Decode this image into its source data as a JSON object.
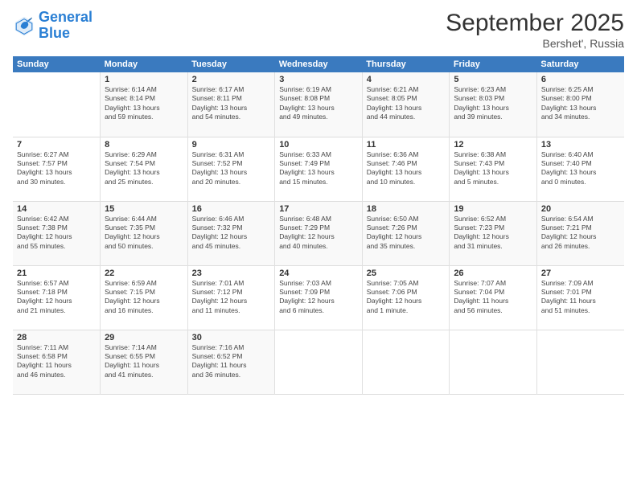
{
  "logo": {
    "line1": "General",
    "line2": "Blue"
  },
  "title": "September 2025",
  "subtitle": "Bershet', Russia",
  "days_of_week": [
    "Sunday",
    "Monday",
    "Tuesday",
    "Wednesday",
    "Thursday",
    "Friday",
    "Saturday"
  ],
  "weeks": [
    [
      {
        "day": "",
        "info": ""
      },
      {
        "day": "1",
        "info": "Sunrise: 6:14 AM\nSunset: 8:14 PM\nDaylight: 13 hours\nand 59 minutes."
      },
      {
        "day": "2",
        "info": "Sunrise: 6:17 AM\nSunset: 8:11 PM\nDaylight: 13 hours\nand 54 minutes."
      },
      {
        "day": "3",
        "info": "Sunrise: 6:19 AM\nSunset: 8:08 PM\nDaylight: 13 hours\nand 49 minutes."
      },
      {
        "day": "4",
        "info": "Sunrise: 6:21 AM\nSunset: 8:05 PM\nDaylight: 13 hours\nand 44 minutes."
      },
      {
        "day": "5",
        "info": "Sunrise: 6:23 AM\nSunset: 8:03 PM\nDaylight: 13 hours\nand 39 minutes."
      },
      {
        "day": "6",
        "info": "Sunrise: 6:25 AM\nSunset: 8:00 PM\nDaylight: 13 hours\nand 34 minutes."
      }
    ],
    [
      {
        "day": "7",
        "info": "Sunrise: 6:27 AM\nSunset: 7:57 PM\nDaylight: 13 hours\nand 30 minutes."
      },
      {
        "day": "8",
        "info": "Sunrise: 6:29 AM\nSunset: 7:54 PM\nDaylight: 13 hours\nand 25 minutes."
      },
      {
        "day": "9",
        "info": "Sunrise: 6:31 AM\nSunset: 7:52 PM\nDaylight: 13 hours\nand 20 minutes."
      },
      {
        "day": "10",
        "info": "Sunrise: 6:33 AM\nSunset: 7:49 PM\nDaylight: 13 hours\nand 15 minutes."
      },
      {
        "day": "11",
        "info": "Sunrise: 6:36 AM\nSunset: 7:46 PM\nDaylight: 13 hours\nand 10 minutes."
      },
      {
        "day": "12",
        "info": "Sunrise: 6:38 AM\nSunset: 7:43 PM\nDaylight: 13 hours\nand 5 minutes."
      },
      {
        "day": "13",
        "info": "Sunrise: 6:40 AM\nSunset: 7:40 PM\nDaylight: 13 hours\nand 0 minutes."
      }
    ],
    [
      {
        "day": "14",
        "info": "Sunrise: 6:42 AM\nSunset: 7:38 PM\nDaylight: 12 hours\nand 55 minutes."
      },
      {
        "day": "15",
        "info": "Sunrise: 6:44 AM\nSunset: 7:35 PM\nDaylight: 12 hours\nand 50 minutes."
      },
      {
        "day": "16",
        "info": "Sunrise: 6:46 AM\nSunset: 7:32 PM\nDaylight: 12 hours\nand 45 minutes."
      },
      {
        "day": "17",
        "info": "Sunrise: 6:48 AM\nSunset: 7:29 PM\nDaylight: 12 hours\nand 40 minutes."
      },
      {
        "day": "18",
        "info": "Sunrise: 6:50 AM\nSunset: 7:26 PM\nDaylight: 12 hours\nand 35 minutes."
      },
      {
        "day": "19",
        "info": "Sunrise: 6:52 AM\nSunset: 7:23 PM\nDaylight: 12 hours\nand 31 minutes."
      },
      {
        "day": "20",
        "info": "Sunrise: 6:54 AM\nSunset: 7:21 PM\nDaylight: 12 hours\nand 26 minutes."
      }
    ],
    [
      {
        "day": "21",
        "info": "Sunrise: 6:57 AM\nSunset: 7:18 PM\nDaylight: 12 hours\nand 21 minutes."
      },
      {
        "day": "22",
        "info": "Sunrise: 6:59 AM\nSunset: 7:15 PM\nDaylight: 12 hours\nand 16 minutes."
      },
      {
        "day": "23",
        "info": "Sunrise: 7:01 AM\nSunset: 7:12 PM\nDaylight: 12 hours\nand 11 minutes."
      },
      {
        "day": "24",
        "info": "Sunrise: 7:03 AM\nSunset: 7:09 PM\nDaylight: 12 hours\nand 6 minutes."
      },
      {
        "day": "25",
        "info": "Sunrise: 7:05 AM\nSunset: 7:06 PM\nDaylight: 12 hours\nand 1 minute."
      },
      {
        "day": "26",
        "info": "Sunrise: 7:07 AM\nSunset: 7:04 PM\nDaylight: 11 hours\nand 56 minutes."
      },
      {
        "day": "27",
        "info": "Sunrise: 7:09 AM\nSunset: 7:01 PM\nDaylight: 11 hours\nand 51 minutes."
      }
    ],
    [
      {
        "day": "28",
        "info": "Sunrise: 7:11 AM\nSunset: 6:58 PM\nDaylight: 11 hours\nand 46 minutes."
      },
      {
        "day": "29",
        "info": "Sunrise: 7:14 AM\nSunset: 6:55 PM\nDaylight: 11 hours\nand 41 minutes."
      },
      {
        "day": "30",
        "info": "Sunrise: 7:16 AM\nSunset: 6:52 PM\nDaylight: 11 hours\nand 36 minutes."
      },
      {
        "day": "",
        "info": ""
      },
      {
        "day": "",
        "info": ""
      },
      {
        "day": "",
        "info": ""
      },
      {
        "day": "",
        "info": ""
      }
    ]
  ]
}
